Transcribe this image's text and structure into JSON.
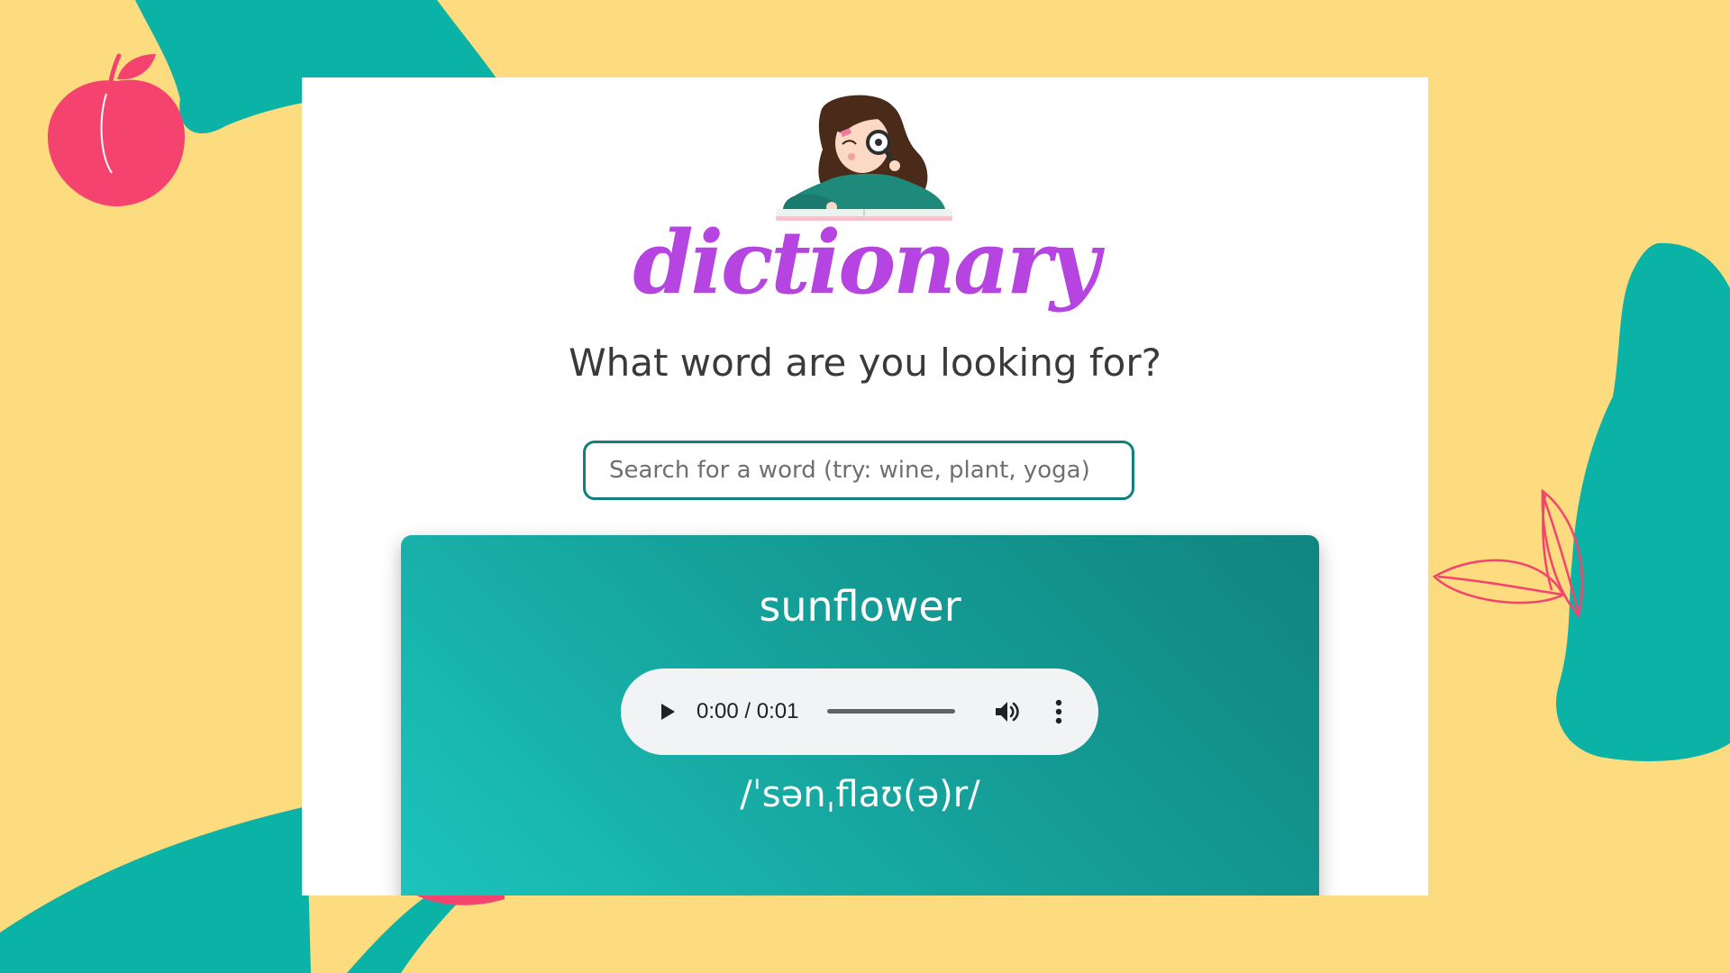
{
  "header": {
    "brand_title": "dictionary",
    "tagline": "What word are you looking for?"
  },
  "search": {
    "placeholder": "Search for a word (try: wine, plant, yoga)",
    "value": ""
  },
  "result": {
    "word": "sunflower",
    "phonetic": "/ˈsənˌflaʊ(ə)r/",
    "audio": {
      "time": "0:00 / 0:01",
      "progress": 0
    }
  },
  "icons": {
    "play": "play-icon",
    "volume": "volume-icon",
    "more": "more-vertical-icon"
  },
  "colors": {
    "background": "#fcdc7f",
    "decor_teal": "#0bb3a7",
    "decor_pink": "#f5436f",
    "brand_purple": "#b544e0",
    "search_border": "#12807a",
    "card_gradient_start": "#1bc5bc",
    "card_gradient_end": "#11857f"
  }
}
